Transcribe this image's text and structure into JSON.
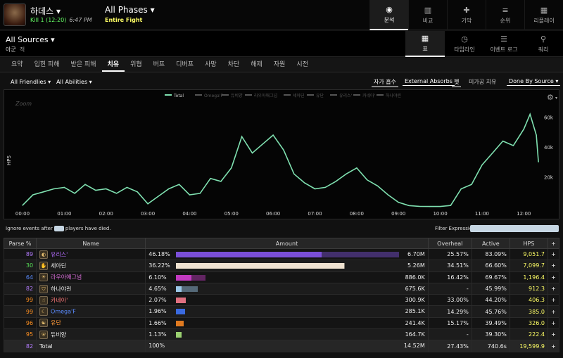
{
  "header": {
    "boss": "하데스",
    "kill": "Kill 1 (12:20)",
    "time": "6:47 PM",
    "phases": "All Phases",
    "fight": "Entire Fight",
    "nav": [
      {
        "label": "분석",
        "icon": "eye-icon",
        "glyph": "◉"
      },
      {
        "label": "비교",
        "icon": "book-icon",
        "glyph": "▥"
      },
      {
        "label": "기막",
        "icon": "puzzle-icon",
        "glyph": "✚"
      },
      {
        "label": "순위",
        "icon": "rank-icon",
        "glyph": "≡"
      },
      {
        "label": "리플레이",
        "icon": "film-icon",
        "glyph": "▦"
      }
    ]
  },
  "source": {
    "title": "All Sources",
    "ally": "아군",
    "enemy": "적"
  },
  "views": [
    {
      "label": "표",
      "icon": "table-icon",
      "glyph": "▦"
    },
    {
      "label": "타임라인",
      "icon": "clock-icon",
      "glyph": "◷"
    },
    {
      "label": "이벤트 로그",
      "icon": "list-icon",
      "glyph": "☰"
    },
    {
      "label": "쿼리",
      "icon": "pin-icon",
      "glyph": "⚲"
    }
  ],
  "tabs": [
    "요약",
    "입힌 피해",
    "받은 피해",
    "치유",
    "위협",
    "버프",
    "디버프",
    "사망",
    "차단",
    "해제",
    "자원",
    "시전"
  ],
  "filters": {
    "friendlies": "All Friendlies",
    "abilities": "All Abilities",
    "self_absorb": "자가 흡수",
    "external": "External Absorbs",
    "pet": "펫",
    "unprocessed": "미가공 치유",
    "done_by": "Done By Source"
  },
  "chart_data": {
    "type": "line",
    "title": "",
    "xlabel": "",
    "ylabel": "HPS",
    "zoom_label": "Zoom",
    "legend": [
      "Total",
      "Omega'F",
      "듀비양",
      "라우아애그넘",
      "세아딘",
      "유단",
      "유리스'",
      "카네아'",
      "하나야린"
    ],
    "x_ticks": [
      "00:00",
      "01:00",
      "02:00",
      "03:00",
      "04:00",
      "05:00",
      "06:00",
      "07:00",
      "08:00",
      "09:00",
      "10:00",
      "11:00",
      "12:00"
    ],
    "y_ticks": [
      "20k",
      "40k",
      "60k"
    ],
    "ylim": [
      0,
      65000
    ],
    "line_color": "#7fe0b0",
    "x": [
      0,
      0.25,
      0.5,
      0.75,
      1,
      1.25,
      1.5,
      1.75,
      2,
      2.25,
      2.5,
      2.75,
      3,
      3.25,
      3.5,
      3.75,
      4,
      4.25,
      4.5,
      4.75,
      5,
      5.25,
      5.5,
      5.75,
      6,
      6.25,
      6.5,
      6.75,
      7,
      7.25,
      7.5,
      7.75,
      8,
      8.25,
      8.5,
      8.75,
      9,
      9.25,
      9.5,
      9.75,
      10,
      10.25,
      10.5,
      10.75,
      11,
      11.25,
      11.5,
      11.75,
      12,
      12.15,
      12.3,
      12.35
    ],
    "values": [
      1000,
      8000,
      10000,
      12000,
      13000,
      9000,
      15000,
      11000,
      12000,
      9000,
      13000,
      10000,
      2000,
      7000,
      12000,
      15000,
      8000,
      9000,
      19000,
      17000,
      26000,
      47000,
      36000,
      42000,
      48000,
      38000,
      22000,
      16000,
      12000,
      13000,
      17000,
      22000,
      26000,
      18000,
      14000,
      8000,
      3000,
      800,
      300,
      200,
      200,
      900,
      12000,
      15000,
      28000,
      36000,
      44000,
      41000,
      52000,
      62000,
      48000,
      30000
    ]
  },
  "table": {
    "headers": [
      "Parse %",
      "Name",
      "Amount",
      "Overheal",
      "Active",
      "HPS",
      "+"
    ],
    "rows": [
      {
        "parse": "89",
        "parse_color": "#b47cff",
        "name": "유리스'",
        "name_color": "#b46cff",
        "pct": "46.18%",
        "frac": 0.645,
        "frac2": 0.99,
        "bar_color": "#7b4fd8",
        "amount": "6.70M",
        "overheal": "25.57%",
        "active": "83.09%",
        "hps": "9,051.7",
        "icon": "spec-icon",
        "glyph": "◐"
      },
      {
        "parse": "30",
        "parse_color": "#57e057",
        "name": "세아딘",
        "name_color": "#eee",
        "pct": "36.22%",
        "frac": 0.745,
        "frac2": 0.75,
        "bar_color": "#efe2d0",
        "amount": "5.26M",
        "overheal": "34.51%",
        "active": "66.60%",
        "hps": "7,099.7",
        "icon": "spec-icon",
        "glyph": "✋"
      },
      {
        "parse": "64",
        "parse_color": "#5a8cff",
        "name": "라우아애그넘",
        "name_color": "#e070e0",
        "pct": "6.10%",
        "frac": 0.068,
        "frac2": 0.13,
        "bar_color": "#c23ac0",
        "amount": "886.0K",
        "overheal": "16.42%",
        "active": "69.67%",
        "hps": "1,196.4",
        "icon": "spec-icon",
        "glyph": "☀"
      },
      {
        "parse": "82",
        "parse_color": "#b47cff",
        "name": "하나야린",
        "name_color": "#eee",
        "pct": "4.65%",
        "frac": 0.025,
        "frac2": 0.095,
        "bar_color": "#9cc8e8",
        "amount": "675.6K",
        "overheal": "-",
        "active": "45.99%",
        "hps": "912.3",
        "icon": "spec-icon",
        "glyph": "⛉"
      },
      {
        "parse": "99",
        "parse_color": "#ff9020",
        "name": "카네아'",
        "name_color": "#ff7a7a",
        "pct": "2.07%",
        "frac": 0.043,
        "frac2": 0.043,
        "bar_color": "#e07080",
        "amount": "300.9K",
        "overheal": "33.00%",
        "active": "44.20%",
        "hps": "406.3",
        "icon": "spec-icon",
        "glyph": "☝"
      },
      {
        "parse": "99",
        "parse_color": "#ff9020",
        "name": "Omega'F",
        "name_color": "#5a8cff",
        "pct": "1.96%",
        "frac": 0.041,
        "frac2": 0.041,
        "bar_color": "#3a6ae0",
        "amount": "285.1K",
        "overheal": "14.29%",
        "active": "45.76%",
        "hps": "385.0",
        "icon": "spec-icon",
        "glyph": "☾"
      },
      {
        "parse": "96",
        "parse_color": "#ff9020",
        "name": "유단",
        "name_color": "#ff9a3a",
        "pct": "1.66%",
        "frac": 0.035,
        "frac2": 0.035,
        "bar_color": "#e07a20",
        "amount": "241.4K",
        "overheal": "15.17%",
        "active": "39.49%",
        "hps": "326.0",
        "icon": "spec-icon",
        "glyph": "☯"
      },
      {
        "parse": "95",
        "parse_color": "#ff9020",
        "name": "듀비양",
        "name_color": "#eee",
        "pct": "1.13%",
        "frac": 0.024,
        "frac2": 0.024,
        "bar_color": "#9ad070",
        "amount": "164.7K",
        "overheal": "-",
        "active": "39.30%",
        "hps": "222.4",
        "icon": "spec-icon",
        "glyph": "⛨"
      }
    ],
    "total": {
      "parse": "82",
      "parse_color": "#b47cff",
      "name": "Total",
      "pct": "100%",
      "amount": "14.52M",
      "overheal": "27.43%",
      "active": "740.6s",
      "hps": "19,599.9"
    }
  },
  "notes": {
    "ignore1": "Ignore events after",
    "ignore2": "players have died.",
    "filter": "Filter Expression:"
  }
}
